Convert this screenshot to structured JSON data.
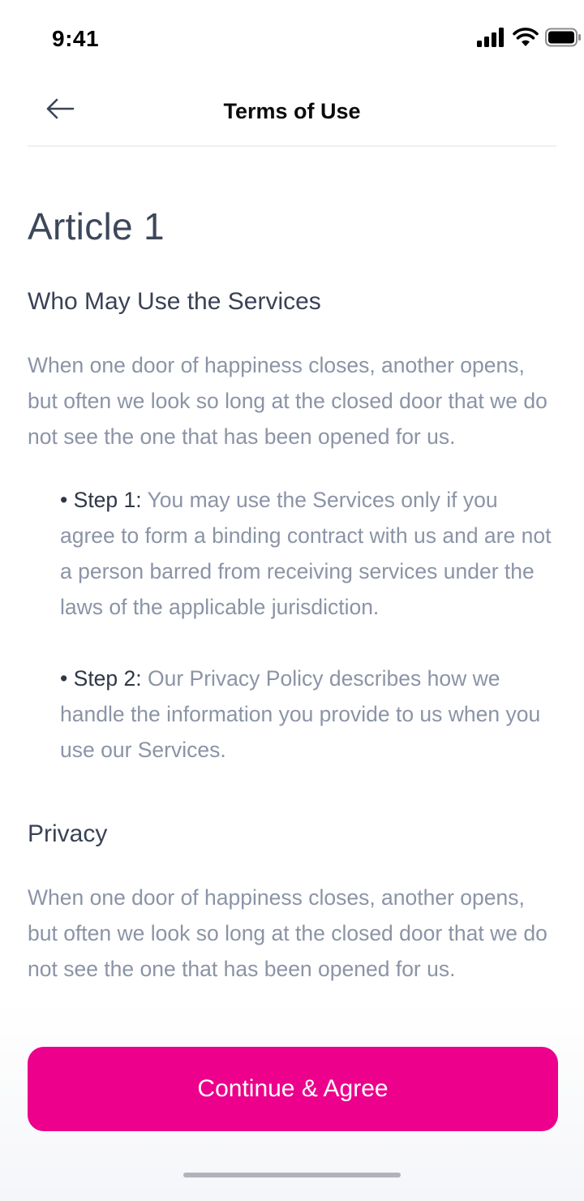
{
  "status_bar": {
    "time": "9:41",
    "icons": [
      "signal-icon",
      "wifi-icon",
      "battery-icon"
    ]
  },
  "nav": {
    "back_icon": "arrow-left-icon",
    "title": "Terms of Use"
  },
  "article": {
    "title": "Article 1",
    "sections": [
      {
        "heading": "Who May Use the Services",
        "paragraph": "When one door of happiness closes, another opens, but often we look so long at the closed door that we do not see the one that has been opened for us.",
        "steps": [
          {
            "label": "• Step 1:",
            "text": "You may use the Services only if you agree to form a binding contract with us and are not a person barred from receiving services under the laws of the applicable jurisdiction."
          },
          {
            "label": "• Step 2:",
            "text": "Our Privacy Policy describes how we handle the information you provide to us when you use our Services."
          }
        ]
      },
      {
        "heading": "Privacy",
        "paragraph": "When one door of happiness closes, another opens, but often we look so long at the closed door that we do not see the one that has been opened for us."
      }
    ]
  },
  "cta": {
    "label": "Continue & Agree"
  },
  "colors": {
    "accent": "#ec008c",
    "heading": "#3d475a",
    "body_text": "#8b94a6",
    "step_label": "#2f3747"
  }
}
